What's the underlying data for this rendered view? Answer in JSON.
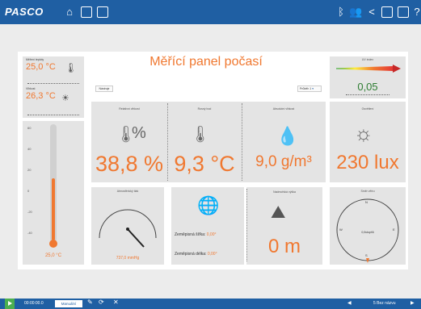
{
  "app": {
    "logo": "PASCO"
  },
  "header": {
    "title": "Měřící panel počasí"
  },
  "left": {
    "temp_label": "Měření teploty",
    "temp_value": "25,0 °C",
    "hum_label": "Vlhkost",
    "hum_value": "26,3 °C",
    "thermo_ticks": [
      "60",
      "40",
      "20",
      "0",
      "-20",
      "-40"
    ],
    "thermo_fraction": 0.55,
    "thermo_value": "25,0 °C"
  },
  "controls": {
    "left_button": "Nástroje",
    "right_dropdown": "Průběh 1"
  },
  "tiles": {
    "humidity": {
      "label": "Relativní vlhkost",
      "value": "38,8 %"
    },
    "dewpoint": {
      "label": "Rosný bod",
      "value": "9,3 °C"
    },
    "abs_hum": {
      "label": "Absolutní vlhkost",
      "value": "9,0 g/m³"
    },
    "light": {
      "label": "Osvětlení",
      "value": "230 lux"
    }
  },
  "uv": {
    "label": "UV index",
    "value": "0,05"
  },
  "pressure": {
    "label": "Atmosférický tlak",
    "value": "737,0 mmHg",
    "ticks": [
      "200",
      "250",
      "300",
      "350",
      "400"
    ]
  },
  "geo": {
    "lat_label": "Zeměpisná šířka:",
    "lat_value": "0,00°",
    "lon_label": "Zeměpisná délka:",
    "lon_value": "0,00°"
  },
  "altitude": {
    "label": "Nadmořská výška",
    "value": "0 m"
  },
  "compass": {
    "label": "Směr větru",
    "north": "N",
    "south": "S",
    "east": "E",
    "west": "W",
    "heading_label": "0,0stupňů"
  },
  "bottom": {
    "time": "00:00:00.0",
    "mode": "Manuální",
    "page": "5 Bez názvu"
  },
  "colors": {
    "accent": "#f07830",
    "primary": "#1f5fa3"
  }
}
